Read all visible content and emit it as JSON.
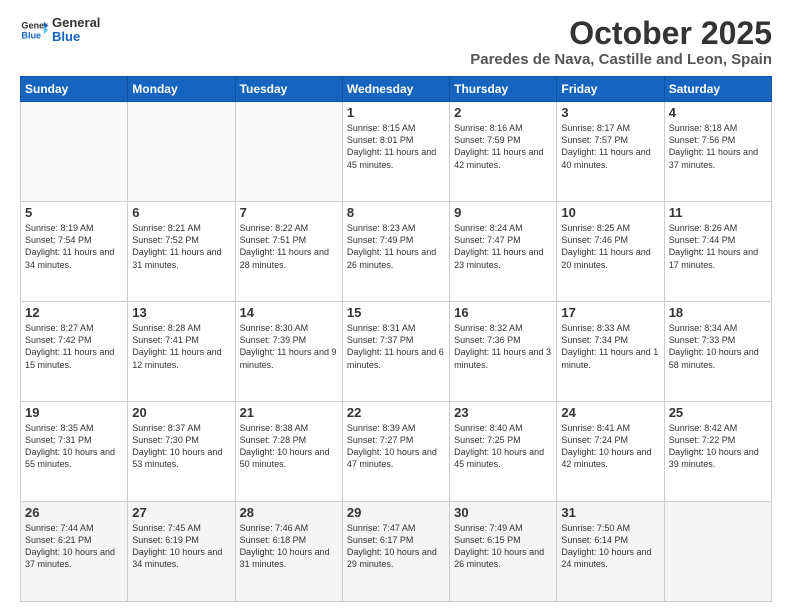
{
  "logo": {
    "general": "General",
    "blue": "Blue"
  },
  "header": {
    "month": "October 2025",
    "location": "Paredes de Nava, Castille and Leon, Spain"
  },
  "weekdays": [
    "Sunday",
    "Monday",
    "Tuesday",
    "Wednesday",
    "Thursday",
    "Friday",
    "Saturday"
  ],
  "weeks": [
    [
      {
        "day": "",
        "info": ""
      },
      {
        "day": "",
        "info": ""
      },
      {
        "day": "",
        "info": ""
      },
      {
        "day": "1",
        "info": "Sunrise: 8:15 AM\nSunset: 8:01 PM\nDaylight: 11 hours and 45 minutes."
      },
      {
        "day": "2",
        "info": "Sunrise: 8:16 AM\nSunset: 7:59 PM\nDaylight: 11 hours and 42 minutes."
      },
      {
        "day": "3",
        "info": "Sunrise: 8:17 AM\nSunset: 7:57 PM\nDaylight: 11 hours and 40 minutes."
      },
      {
        "day": "4",
        "info": "Sunrise: 8:18 AM\nSunset: 7:56 PM\nDaylight: 11 hours and 37 minutes."
      }
    ],
    [
      {
        "day": "5",
        "info": "Sunrise: 8:19 AM\nSunset: 7:54 PM\nDaylight: 11 hours and 34 minutes."
      },
      {
        "day": "6",
        "info": "Sunrise: 8:21 AM\nSunset: 7:52 PM\nDaylight: 11 hours and 31 minutes."
      },
      {
        "day": "7",
        "info": "Sunrise: 8:22 AM\nSunset: 7:51 PM\nDaylight: 11 hours and 28 minutes."
      },
      {
        "day": "8",
        "info": "Sunrise: 8:23 AM\nSunset: 7:49 PM\nDaylight: 11 hours and 26 minutes."
      },
      {
        "day": "9",
        "info": "Sunrise: 8:24 AM\nSunset: 7:47 PM\nDaylight: 11 hours and 23 minutes."
      },
      {
        "day": "10",
        "info": "Sunrise: 8:25 AM\nSunset: 7:46 PM\nDaylight: 11 hours and 20 minutes."
      },
      {
        "day": "11",
        "info": "Sunrise: 8:26 AM\nSunset: 7:44 PM\nDaylight: 11 hours and 17 minutes."
      }
    ],
    [
      {
        "day": "12",
        "info": "Sunrise: 8:27 AM\nSunset: 7:42 PM\nDaylight: 11 hours and 15 minutes."
      },
      {
        "day": "13",
        "info": "Sunrise: 8:28 AM\nSunset: 7:41 PM\nDaylight: 11 hours and 12 minutes."
      },
      {
        "day": "14",
        "info": "Sunrise: 8:30 AM\nSunset: 7:39 PM\nDaylight: 11 hours and 9 minutes."
      },
      {
        "day": "15",
        "info": "Sunrise: 8:31 AM\nSunset: 7:37 PM\nDaylight: 11 hours and 6 minutes."
      },
      {
        "day": "16",
        "info": "Sunrise: 8:32 AM\nSunset: 7:36 PM\nDaylight: 11 hours and 3 minutes."
      },
      {
        "day": "17",
        "info": "Sunrise: 8:33 AM\nSunset: 7:34 PM\nDaylight: 11 hours and 1 minute."
      },
      {
        "day": "18",
        "info": "Sunrise: 8:34 AM\nSunset: 7:33 PM\nDaylight: 10 hours and 58 minutes."
      }
    ],
    [
      {
        "day": "19",
        "info": "Sunrise: 8:35 AM\nSunset: 7:31 PM\nDaylight: 10 hours and 55 minutes."
      },
      {
        "day": "20",
        "info": "Sunrise: 8:37 AM\nSunset: 7:30 PM\nDaylight: 10 hours and 53 minutes."
      },
      {
        "day": "21",
        "info": "Sunrise: 8:38 AM\nSunset: 7:28 PM\nDaylight: 10 hours and 50 minutes."
      },
      {
        "day": "22",
        "info": "Sunrise: 8:39 AM\nSunset: 7:27 PM\nDaylight: 10 hours and 47 minutes."
      },
      {
        "day": "23",
        "info": "Sunrise: 8:40 AM\nSunset: 7:25 PM\nDaylight: 10 hours and 45 minutes."
      },
      {
        "day": "24",
        "info": "Sunrise: 8:41 AM\nSunset: 7:24 PM\nDaylight: 10 hours and 42 minutes."
      },
      {
        "day": "25",
        "info": "Sunrise: 8:42 AM\nSunset: 7:22 PM\nDaylight: 10 hours and 39 minutes."
      }
    ],
    [
      {
        "day": "26",
        "info": "Sunrise: 7:44 AM\nSunset: 6:21 PM\nDaylight: 10 hours and 37 minutes."
      },
      {
        "day": "27",
        "info": "Sunrise: 7:45 AM\nSunset: 6:19 PM\nDaylight: 10 hours and 34 minutes."
      },
      {
        "day": "28",
        "info": "Sunrise: 7:46 AM\nSunset: 6:18 PM\nDaylight: 10 hours and 31 minutes."
      },
      {
        "day": "29",
        "info": "Sunrise: 7:47 AM\nSunset: 6:17 PM\nDaylight: 10 hours and 29 minutes."
      },
      {
        "day": "30",
        "info": "Sunrise: 7:49 AM\nSunset: 6:15 PM\nDaylight: 10 hours and 26 minutes."
      },
      {
        "day": "31",
        "info": "Sunrise: 7:50 AM\nSunset: 6:14 PM\nDaylight: 10 hours and 24 minutes."
      },
      {
        "day": "",
        "info": ""
      }
    ]
  ]
}
